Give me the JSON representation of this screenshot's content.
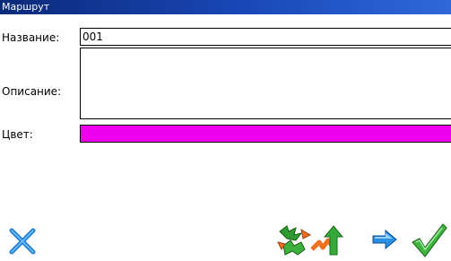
{
  "window": {
    "title": "Маршрут"
  },
  "form": {
    "name_label": "Название:",
    "name_value": "001",
    "description_label": "Описание:",
    "description_value": "",
    "color_label": "Цвет:",
    "color_value": "#ee00ee"
  },
  "toolbar": {
    "icons": [
      "close-icon",
      "waypoints-icon",
      "route-edit-icon",
      "next-arrow-icon",
      "confirm-check-icon"
    ]
  }
}
